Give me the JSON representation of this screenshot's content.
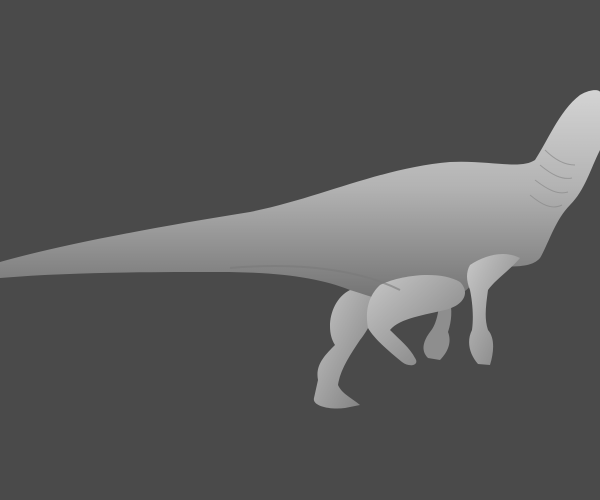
{
  "scene": {
    "background_color": "#4a4a4a",
    "model_base_color": "#a9a9a9",
    "model_highlight_color": "#d6d6d6",
    "model_shadow_color": "#6a6a6a",
    "subject": "dinosaur-sculpt"
  }
}
